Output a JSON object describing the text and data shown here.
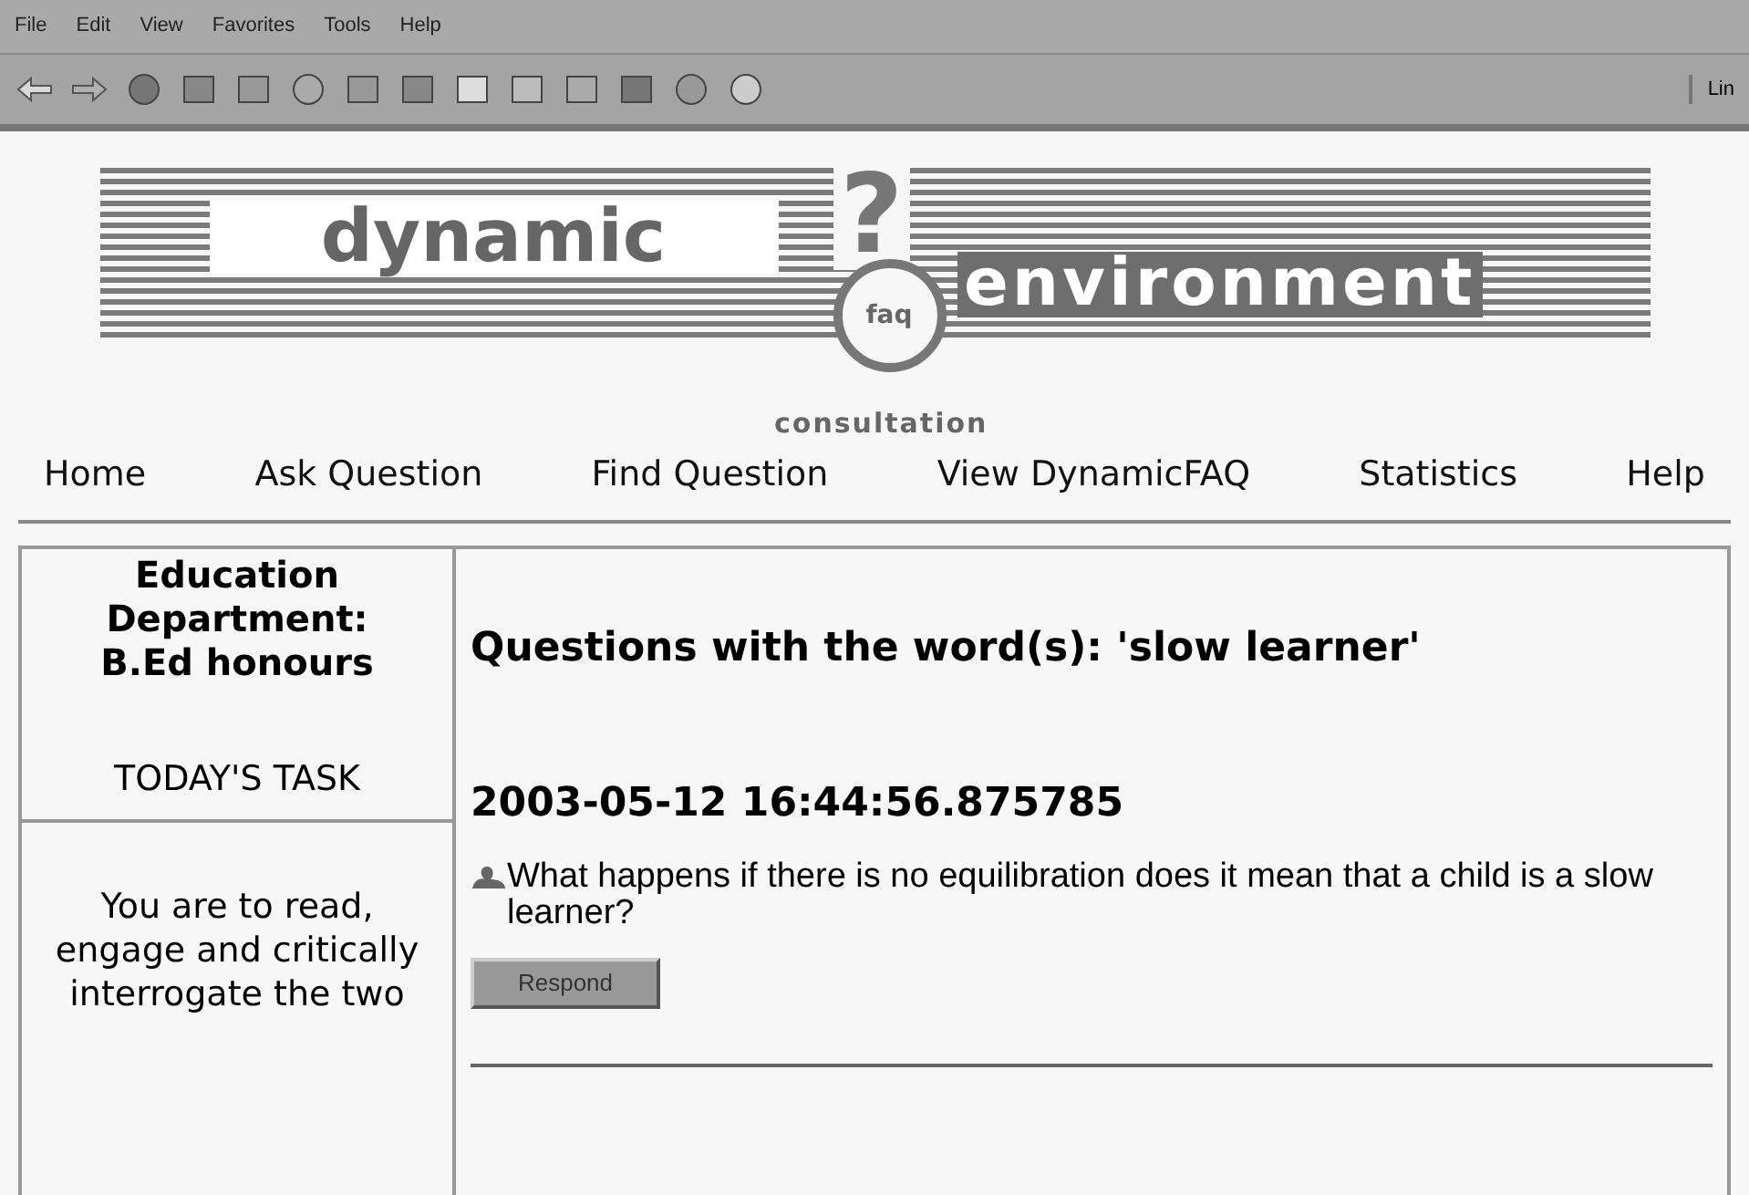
{
  "menu_bar": [
    "File",
    "Edit",
    "View",
    "Favorites",
    "Tools",
    "Help"
  ],
  "toolbar": {
    "links_label": "Lin"
  },
  "logo": {
    "word_1": "dynamic",
    "mark": "?",
    "badge": "faq",
    "word_2": "environment",
    "caption": "consultation"
  },
  "nav": [
    "Home",
    "Ask Question",
    "Find Question",
    "View DynamicFAQ",
    "Statistics",
    "Help"
  ],
  "sidebar": {
    "title": "Education Department: B.Ed honours",
    "task_heading": "TODAY'S TASK",
    "task_text": "You are to read, engage and critically interrogate the two"
  },
  "main": {
    "heading": "Questions with the word(s): 'slow learner'",
    "timestamp": "2003-05-12 16:44:56.875785",
    "question": "What happens if there is no equilibration does it mean that a child is a slow learner?",
    "button": "Respond"
  }
}
